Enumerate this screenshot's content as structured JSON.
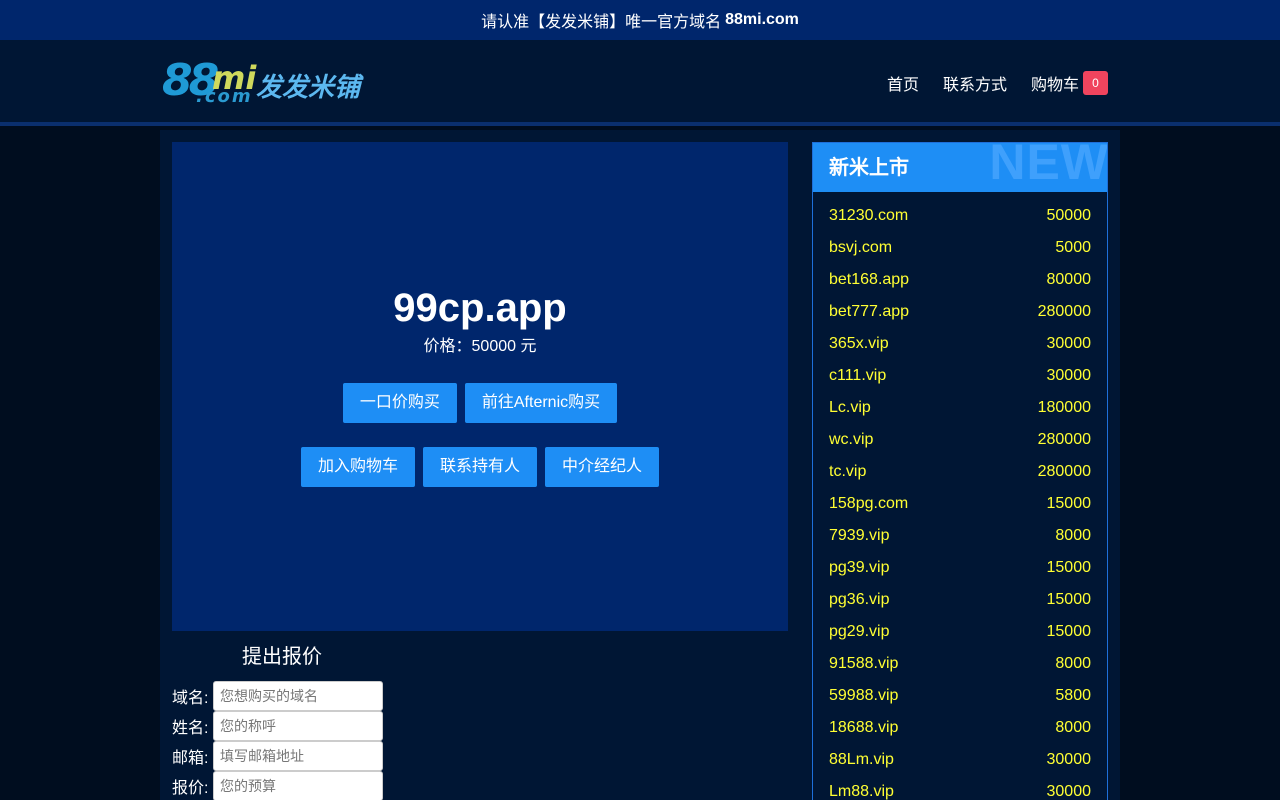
{
  "topbar": {
    "notice": "请认准【发发米铺】唯一官方域名",
    "domain": "88mi.com"
  },
  "logo": {
    "num": "88",
    "mi": "mi",
    "com": ".com",
    "cn": "发发米铺"
  },
  "nav": {
    "home": "首页",
    "contact": "联系方式",
    "cart": "购物车",
    "cart_count": "0"
  },
  "hero": {
    "domain": "99cp.app",
    "price": "价格：50000 元",
    "buttons": {
      "buy_now": "一口价购买",
      "afternic": "前往Afternic购买",
      "add_cart": "加入购物车",
      "contact_owner": "联系持有人",
      "broker": "中介经纪人"
    }
  },
  "offer": {
    "title": "提出报价",
    "fields": [
      {
        "label": "域名:",
        "placeholder": "您想购买的域名"
      },
      {
        "label": "姓名:",
        "placeholder": "您的称呼"
      },
      {
        "label": "邮箱:",
        "placeholder": "填写邮箱地址"
      },
      {
        "label": "报价:",
        "placeholder": "您的预算"
      }
    ]
  },
  "sidebar": {
    "title": "新米上市",
    "watermark": "NEW",
    "items": [
      {
        "domain": "31230.com",
        "price": "50000"
      },
      {
        "domain": "bsvj.com",
        "price": "5000"
      },
      {
        "domain": "bet168.app",
        "price": "80000"
      },
      {
        "domain": "bet777.app",
        "price": "280000"
      },
      {
        "domain": "365x.vip",
        "price": "30000"
      },
      {
        "domain": "c111.vip",
        "price": "30000"
      },
      {
        "domain": "Lc.vip",
        "price": "180000"
      },
      {
        "domain": "wc.vip",
        "price": "280000"
      },
      {
        "domain": "tc.vip",
        "price": "280000"
      },
      {
        "domain": "158pg.com",
        "price": "15000"
      },
      {
        "domain": "7939.vip",
        "price": "8000"
      },
      {
        "domain": "pg39.vip",
        "price": "15000"
      },
      {
        "domain": "pg36.vip",
        "price": "15000"
      },
      {
        "domain": "pg29.vip",
        "price": "15000"
      },
      {
        "domain": "91588.vip",
        "price": "8000"
      },
      {
        "domain": "59988.vip",
        "price": "5800"
      },
      {
        "domain": "18688.vip",
        "price": "8000"
      },
      {
        "domain": "88Lm.vip",
        "price": "30000"
      },
      {
        "domain": "Lm88.vip",
        "price": "30000"
      }
    ]
  }
}
